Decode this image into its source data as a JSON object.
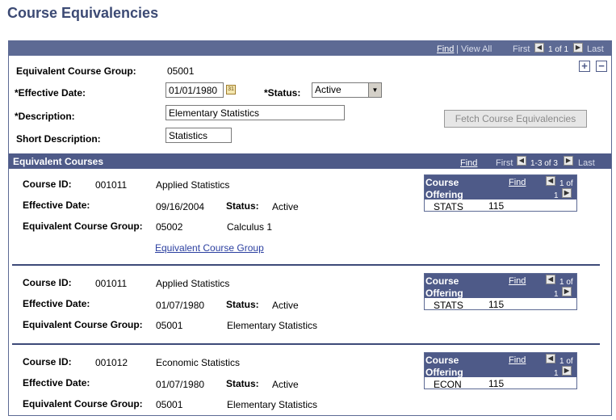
{
  "page": {
    "title": "Course Equivalencies"
  },
  "top_nav": {
    "find": "Find",
    "sep": "|",
    "view_all": "View All",
    "first": "First",
    "count": "1 of 1",
    "last": "Last"
  },
  "form": {
    "group_label": "Equivalent Course Group:",
    "group_value": "05001",
    "eff_date_label": "*Effective Date:",
    "eff_date_value": "01/01/1980",
    "status_label": "*Status:",
    "status_value": "Active",
    "desc_label": "*Description:",
    "desc_value": "Elementary Statistics",
    "short_desc_label": "Short Description:",
    "short_desc_value": "Statistics",
    "fetch_button": "Fetch Course Equivalencies",
    "plus": "+",
    "minus": "−"
  },
  "equiv_section": {
    "title": "Equivalent Courses",
    "find": "Find",
    "first": "First",
    "count": "1-3 of 3",
    "last": "Last"
  },
  "labels": {
    "course_id": "Course ID:",
    "eff_date": "Effective Date:",
    "status": "Status:",
    "group": "Equivalent Course Group:",
    "offering_line1": "Course",
    "offering_line2": "Offering",
    "offering_find": "Find",
    "offering_count_1": "1 of",
    "offering_count_2": "1"
  },
  "courses": [
    {
      "course_id": "001011",
      "course_name": "Applied Statistics",
      "eff_date": "09/16/2004",
      "status": "Active",
      "group": "05002",
      "group_name": "Calculus 1",
      "subject": "STATS",
      "catalog": "115",
      "link": "Equivalent Course Group"
    },
    {
      "course_id": "001011",
      "course_name": "Applied Statistics",
      "eff_date": "01/07/1980",
      "status": "Active",
      "group": "05001",
      "group_name": "Elementary Statistics",
      "subject": "STATS",
      "catalog": "115"
    },
    {
      "course_id": "001012",
      "course_name": "Economic Statistics",
      "eff_date": "01/07/1980",
      "status": "Active",
      "group": "05001",
      "group_name": "Elementary Statistics",
      "subject": "ECON",
      "catalog": "115"
    }
  ]
}
